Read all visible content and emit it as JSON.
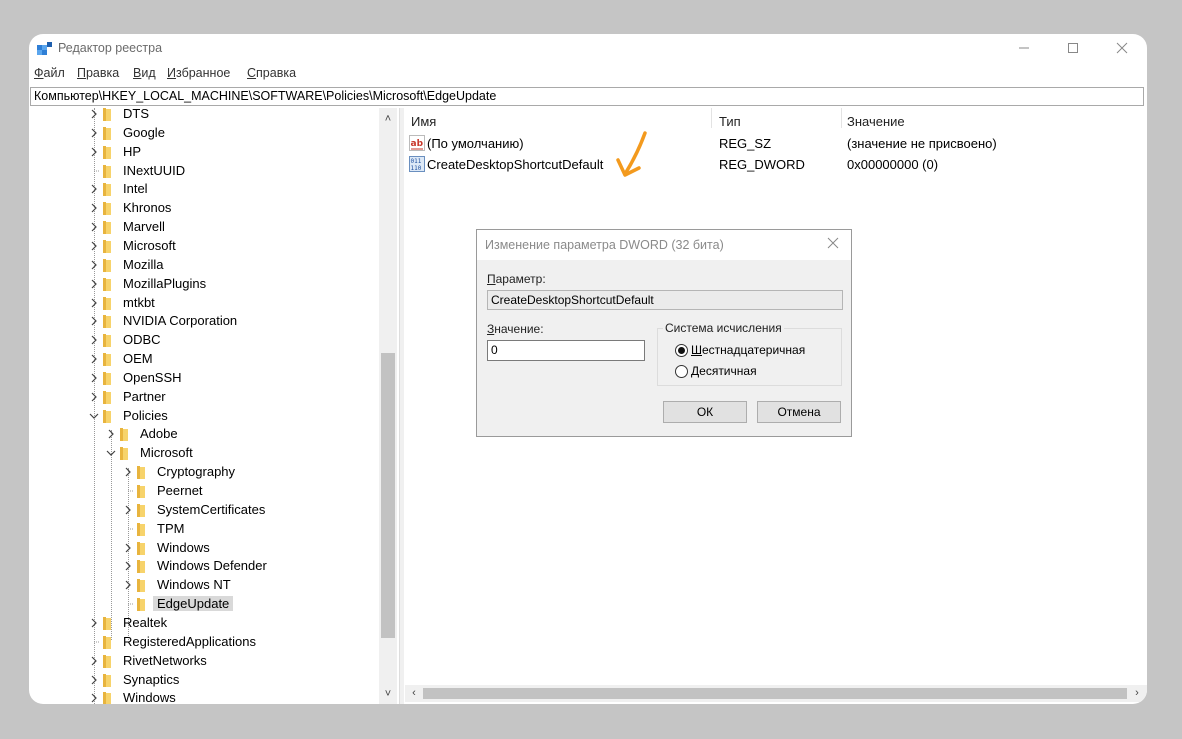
{
  "window": {
    "title": "Редактор реестра"
  },
  "menu": [
    {
      "ul": "Ф",
      "rest": "айл"
    },
    {
      "ul": "П",
      "rest": "равка"
    },
    {
      "ul": "В",
      "rest": "ид"
    },
    {
      "ul": "И",
      "rest": "збранное"
    },
    {
      "ul": "С",
      "rest": "правка"
    }
  ],
  "address": "Компьютер\\HKEY_LOCAL_MACHINE\\SOFTWARE\\Policies\\Microsoft\\EdgeUpdate",
  "tree": [
    {
      "label": "DTS",
      "expander": ">"
    },
    {
      "label": "Google",
      "expander": ">"
    },
    {
      "label": "HP",
      "expander": ">"
    },
    {
      "label": "INextUUID",
      "expander": ""
    },
    {
      "label": "Intel",
      "expander": ">"
    },
    {
      "label": "Khronos",
      "expander": ">"
    },
    {
      "label": "Marvell",
      "expander": ">"
    },
    {
      "label": "Microsoft",
      "expander": ">"
    },
    {
      "label": "Mozilla",
      "expander": ">"
    },
    {
      "label": "MozillaPlugins",
      "expander": ">"
    },
    {
      "label": "mtkbt",
      "expander": ">"
    },
    {
      "label": "NVIDIA Corporation",
      "expander": ">"
    },
    {
      "label": "ODBC",
      "expander": ">"
    },
    {
      "label": "OEM",
      "expander": ">"
    },
    {
      "label": "OpenSSH",
      "expander": ">"
    },
    {
      "label": "Partner",
      "expander": ">"
    },
    {
      "label": "Policies",
      "expander": "v"
    },
    {
      "label": "Adobe",
      "expander": ">"
    },
    {
      "label": "Microsoft",
      "expander": "v"
    },
    {
      "label": "Cryptography",
      "expander": ">"
    },
    {
      "label": "Peernet",
      "expander": ""
    },
    {
      "label": "SystemCertificates",
      "expander": ">"
    },
    {
      "label": "TPM",
      "expander": ""
    },
    {
      "label": "Windows",
      "expander": ">"
    },
    {
      "label": "Windows Defender",
      "expander": ">"
    },
    {
      "label": "Windows NT",
      "expander": ">"
    },
    {
      "label": "EdgeUpdate",
      "expander": ""
    },
    {
      "label": "Realtek",
      "expander": ">"
    },
    {
      "label": "RegisteredApplications",
      "expander": ""
    },
    {
      "label": "RivetNetworks",
      "expander": ">"
    },
    {
      "label": "Synaptics",
      "expander": ">"
    },
    {
      "label": "Windows",
      "expander": ">"
    }
  ],
  "list": {
    "headers": {
      "name": "Имя",
      "type": "Тип",
      "value": "Значение"
    },
    "rows": [
      {
        "icon": "string-value-icon",
        "name": "(По умолчанию)",
        "type": "REG_SZ",
        "value": "(значение не присвоено)"
      },
      {
        "icon": "dword-value-icon",
        "name": "CreateDesktopShortcutDefault",
        "type": "REG_DWORD",
        "value": "0x00000000 (0)"
      }
    ]
  },
  "dialog": {
    "title": "Изменение параметра DWORD (32 бита)",
    "param_label_ul": "П",
    "param_label_rest": "араметр:",
    "param_value": "CreateDesktopShortcutDefault",
    "value_label_ul": "З",
    "value_label_rest": "начение:",
    "value": "0",
    "base_title": "Система исчисления",
    "radio_hex_ul": "Ш",
    "radio_hex_rest": "естнадцатеричная",
    "radio_hex_selected": true,
    "radio_dec_ul": "Д",
    "radio_dec_rest": "есятичная",
    "ok": "ОК",
    "cancel": "Отмена"
  },
  "colors": {
    "accent_arrow": "#f39a1e",
    "folder": "#f7d36b"
  }
}
